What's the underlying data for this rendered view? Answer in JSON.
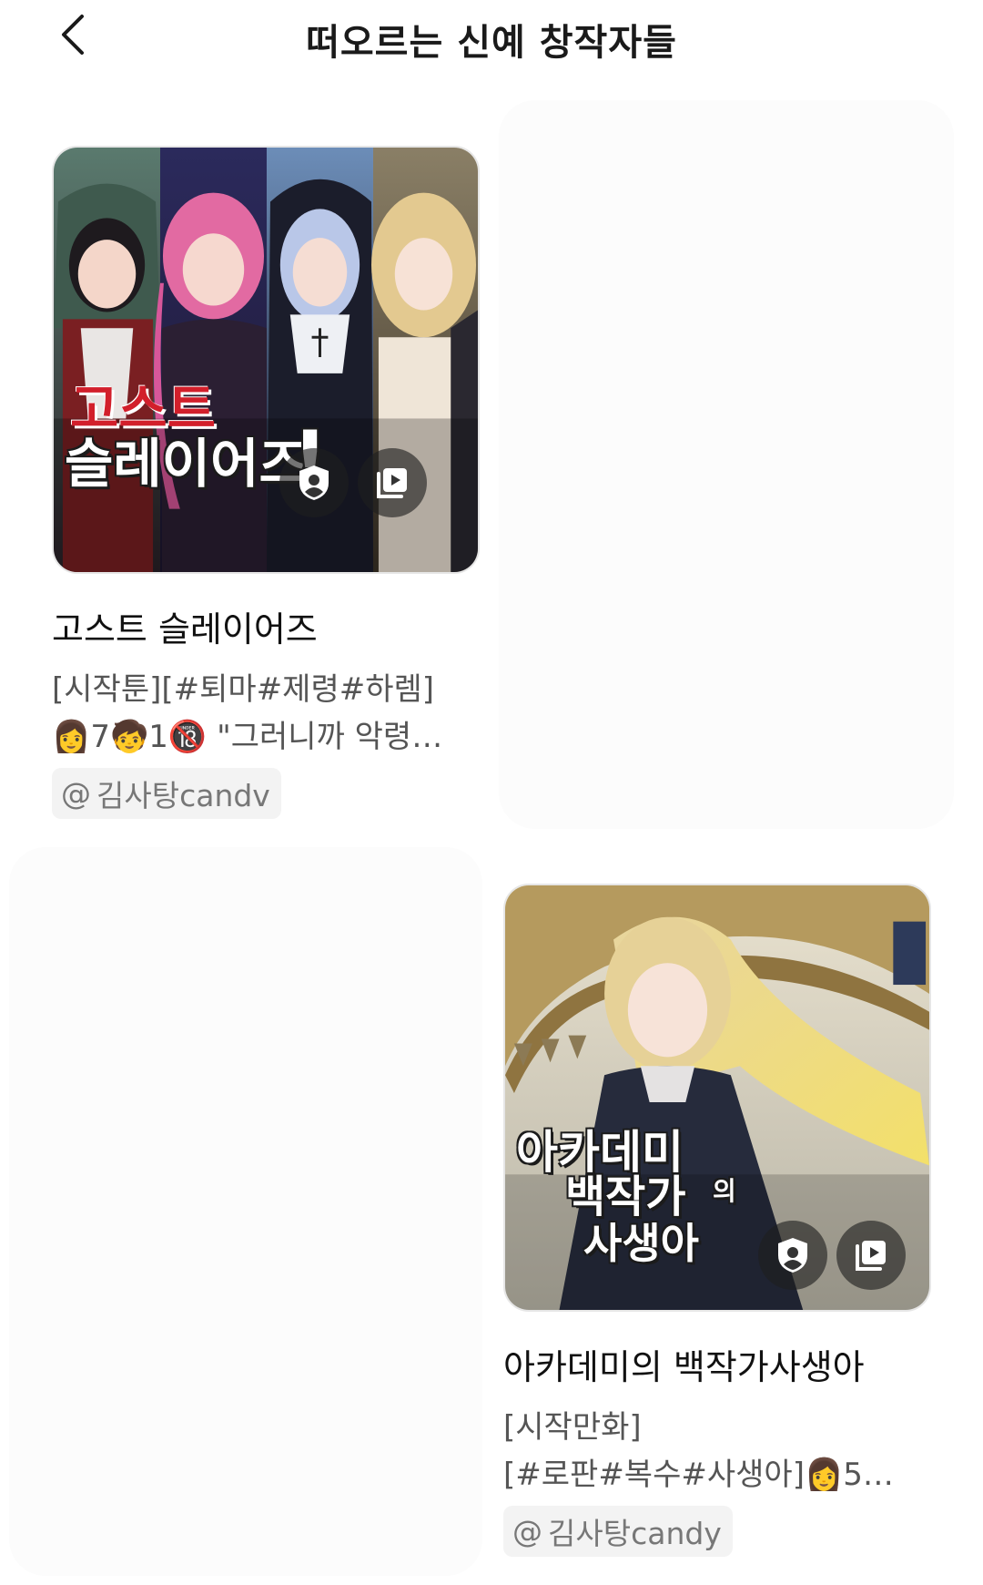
{
  "header": {
    "title": "떠오르는 신예 창작자들"
  },
  "cards": [
    {
      "logo_line1": "고스트",
      "logo_line2": "슬레이어즈",
      "logo_mark": "!",
      "title": "고스트 슬레이어즈",
      "desc_line1": "[시작툰][#퇴마#제령#하렘]",
      "desc_line2": "👩7🧒1🔞 \"그러니까 악령…",
      "author": "김사탕candv",
      "author_prefix": "@"
    },
    {
      "logo_line1": "아카데미",
      "logo_line2": "백작가",
      "logo_small": "의",
      "logo_line3": "사생아",
      "title": "아카데미의 백작가사생아",
      "desc_line1": "[시작만화]",
      "desc_line2": "[#로판#복수#사생아]👩5…",
      "author": "김사탕candy",
      "author_prefix": "@"
    }
  ],
  "icons": {
    "back": "chevron-left-icon",
    "shield": "shield-user-icon",
    "episodes": "episodes-stack-icon"
  },
  "colors": {
    "title": "#1a1a1a",
    "body": "#555555",
    "chip_bg": "#f3f3f3",
    "logo_red": "#d21f2b"
  }
}
